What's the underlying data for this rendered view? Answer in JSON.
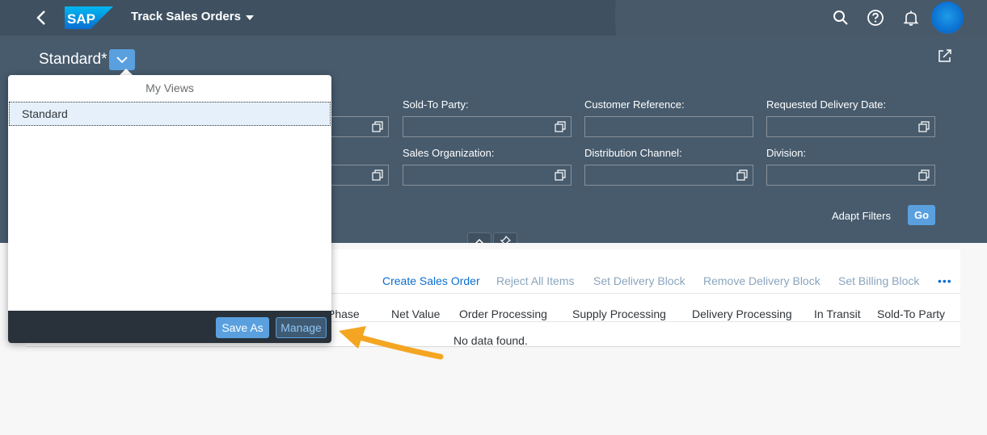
{
  "shell": {
    "logo_text": "SAP",
    "app_title": "Track Sales Orders",
    "icons": [
      "back-icon",
      "search-icon",
      "help-icon",
      "bell-icon",
      "avatar"
    ]
  },
  "header": {
    "variant_name": "Standard*",
    "filters": [
      {
        "label": "Sold-To Party:"
      },
      {
        "label": "Customer Reference:"
      },
      {
        "label": "Requested Delivery Date:"
      },
      {
        "label": "Sales Organization:"
      },
      {
        "label": "Distribution Channel:"
      },
      {
        "label": "Division:"
      }
    ],
    "adapt_filters": "Adapt Filters",
    "go": "Go"
  },
  "toolbar": {
    "create": "Create Sales Order",
    "reject": "Reject All Items",
    "set_delivery_block": "Set Delivery Block",
    "remove_delivery_block": "Remove Delivery Block",
    "set_billing_block": "Set Billing Block",
    "more": "•••"
  },
  "table": {
    "columns": [
      "Phase",
      "Net Value",
      "Order Processing",
      "Supply Processing",
      "Delivery Processing",
      "In Transit",
      "Sold-To Party"
    ],
    "no_data": "No data found."
  },
  "popover": {
    "title": "My Views",
    "items": [
      "Standard"
    ],
    "save_as": "Save As",
    "manage": "Manage"
  },
  "colors": {
    "shell": "#3f5161",
    "header": "#475b6d",
    "accent": "#5aa0df",
    "link": "#0a6ed1",
    "disabled_link": "#8aa5bd",
    "annotation_arrow": "#f4a622"
  }
}
